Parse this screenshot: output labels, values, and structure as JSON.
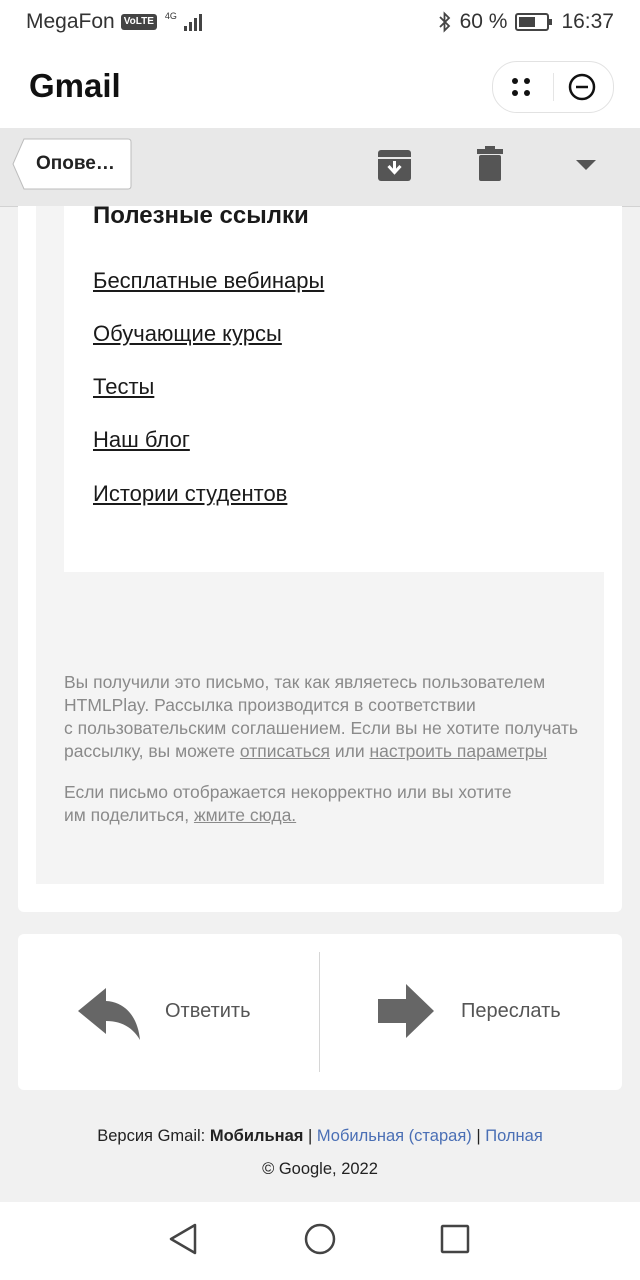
{
  "status_bar": {
    "carrier": "MegaFon",
    "volte": "VoLTE",
    "network": "4G",
    "battery": "60 %",
    "time": "16:37"
  },
  "app": {
    "title": "Gmail"
  },
  "toolbar": {
    "back_label": "Опове…",
    "icons": [
      "archive-icon",
      "trash-icon",
      "dropdown-arrow-icon"
    ]
  },
  "email": {
    "links_title": "Полезные ссылки",
    "links": [
      "Бесплатные вебинары",
      "Обучающие курсы",
      "Тесты",
      "Наш блог",
      "Истории студентов"
    ],
    "footer": {
      "line1": "Вы получили это письмо, так как являетесь пользователем",
      "line2": "HTMLPlay. Рассылка производится в соответствии",
      "line3": "с пользовательским соглашением. Если вы не хотите получать",
      "line4_pre": "рассылку, вы можете ",
      "unsubscribe": "отписаться",
      "line4_mid": " или ",
      "settings": "настроить параметры",
      "line5": "Если письмо отображается некорректно или вы хотите",
      "line6_pre": "им поделиться, ",
      "click_here": "жмите сюда."
    }
  },
  "actions": {
    "reply": "Ответить",
    "forward": "Переслать"
  },
  "gmail_footer": {
    "prefix": "Версия Gmail: ",
    "current": "Мобильная",
    "sep": " | ",
    "old": "Мобильная (старая)",
    "full": "Полная",
    "copyright": "© Google, 2022"
  },
  "colors": {
    "link_blue": "#4a6fb5",
    "footer_gray": "#8a8a8a",
    "toolbar_bg": "#e8e8e8"
  }
}
